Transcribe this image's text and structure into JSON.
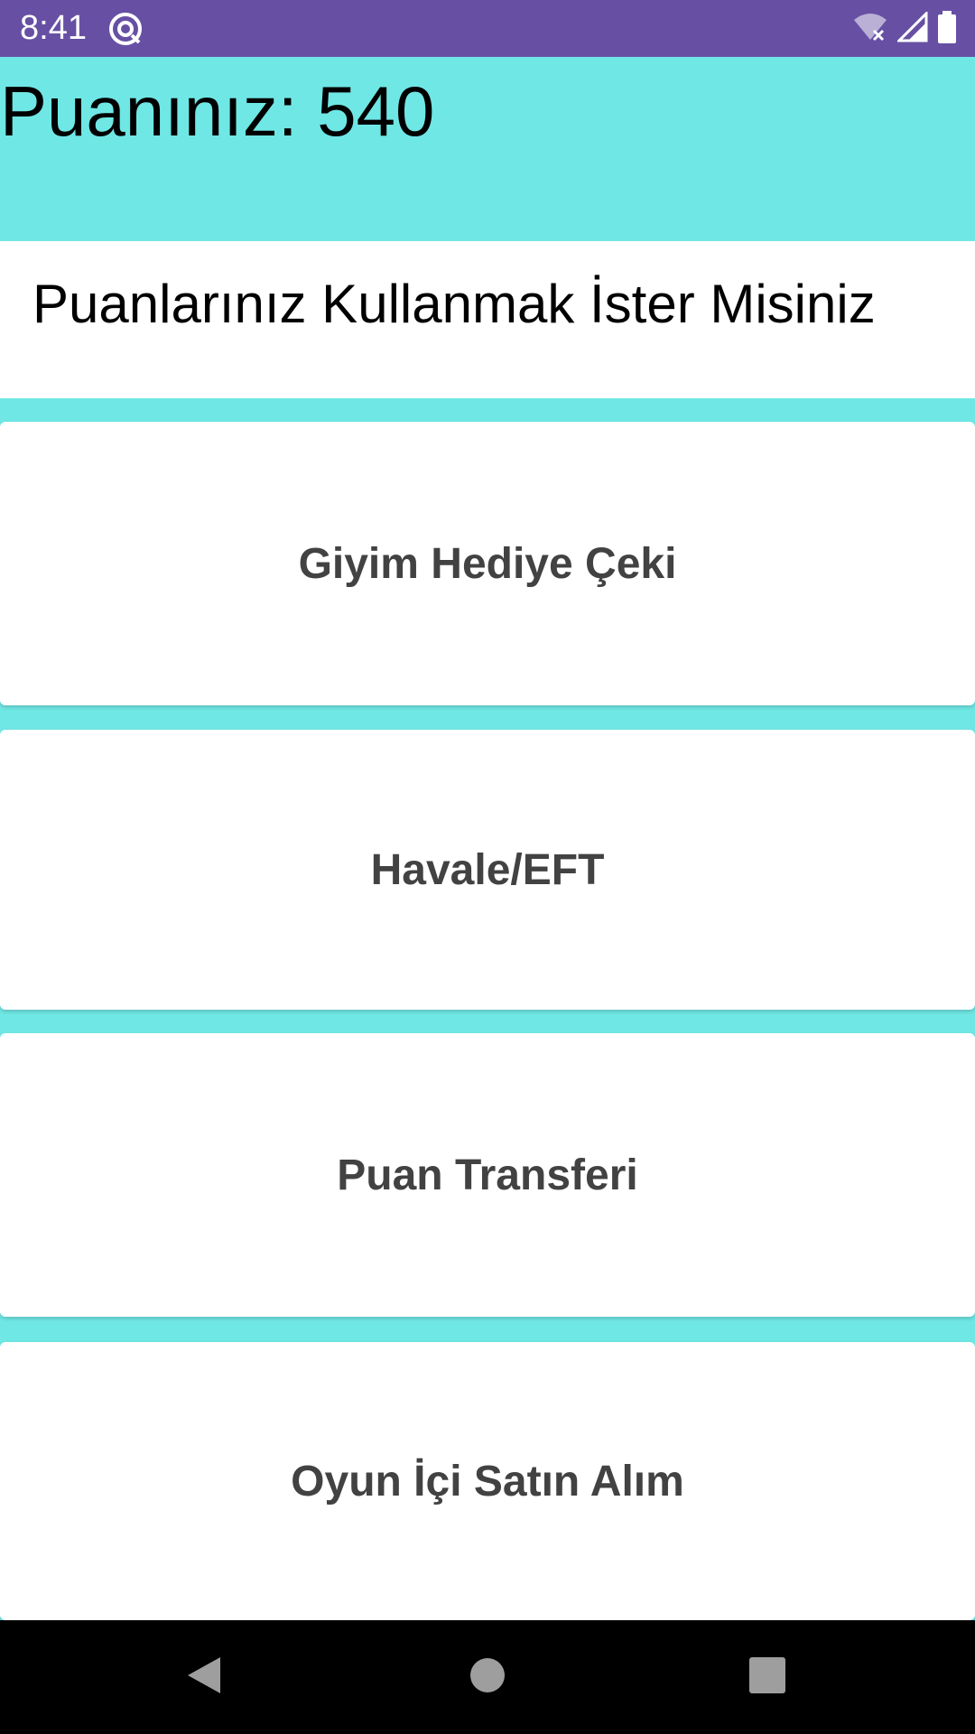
{
  "status_bar": {
    "time": "8:41",
    "app_icon": "at-sign-icon",
    "wifi_icon": "wifi-off-icon",
    "signal_icon": "signal-icon",
    "battery_icon": "battery-icon",
    "background": "#6750a4"
  },
  "header": {
    "score_text": "Puanınız: 540",
    "background": "#6fe7e5"
  },
  "question": {
    "text": "Puanlarınız Kullanmak İster Misiniz"
  },
  "options": [
    {
      "label": "Giyim Hediye Çeki"
    },
    {
      "label": "Havale/EFT"
    },
    {
      "label": "Puan Transferi"
    },
    {
      "label": "Oyun İçi Satın Alım"
    }
  ],
  "nav_bar": {
    "back_icon": "back-triangle-icon",
    "home_icon": "home-circle-icon",
    "recent_icon": "recent-square-icon"
  },
  "colors": {
    "accent": "#6fe7e5",
    "status_bar": "#6750a4",
    "option_text": "#424242"
  }
}
